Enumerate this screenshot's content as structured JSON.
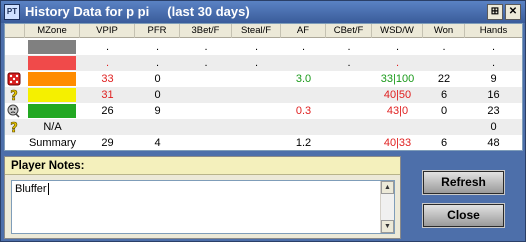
{
  "window": {
    "title": "History Data for p pi     (last 30 days)",
    "app_icon_text": "PT"
  },
  "columns": [
    "MZone",
    "VPIP",
    "PFR",
    "3Bet/F",
    "Steal/F",
    "AF",
    "CBet/F",
    "WSD/W",
    "Won",
    "Hands"
  ],
  "rows": [
    {
      "icon": "",
      "mzone_label": "",
      "mzone_color": "#808080",
      "vpip": ".",
      "pfr": ".",
      "bet3": ".",
      "steal": ".",
      "af": ".",
      "cbet": ".",
      "wsd": ".",
      "won": ".",
      "hands": "."
    },
    {
      "icon": "",
      "mzone_label": "",
      "mzone_color": "#f04a4a",
      "vpip": ".",
      "pfr": ".",
      "bet3": ".",
      "steal": ".",
      "af": "",
      "cbet": ".",
      "wsd": ".",
      "won": "",
      "hands": "."
    },
    {
      "icon": "dice-icon",
      "mzone_label": "",
      "mzone_color": "#ff8c00",
      "vpip": "33",
      "pfr": "0",
      "bet3": "",
      "steal": "",
      "af": "3.0",
      "cbet": "",
      "wsd": "33|100",
      "won": "22",
      "hands": "9"
    },
    {
      "icon": "question-icon",
      "mzone_label": "",
      "mzone_color": "#f5f000",
      "vpip": "31",
      "pfr": "0",
      "bet3": "",
      "steal": "",
      "af": "",
      "cbet": "",
      "wsd": "40|50",
      "won": "6",
      "hands": "16"
    },
    {
      "icon": "thinking-face-icon",
      "mzone_label": "",
      "mzone_color": "#22a822",
      "vpip": "26",
      "pfr": "9",
      "bet3": "",
      "steal": "",
      "af": "0.3",
      "cbet": "",
      "wsd": "43|0",
      "won": "0",
      "hands": "23"
    },
    {
      "icon": "question-icon",
      "mzone_label": "N/A",
      "mzone_color": "",
      "vpip": "",
      "pfr": "",
      "bet3": "",
      "steal": "",
      "af": "",
      "cbet": "",
      "wsd": "",
      "won": "",
      "hands": "0"
    },
    {
      "icon": "",
      "mzone_label": "Summary",
      "mzone_color": "",
      "vpip": "29",
      "pfr": "4",
      "bet3": "",
      "steal": "",
      "af": "1.2",
      "cbet": "",
      "wsd": "40|33",
      "won": "6",
      "hands": "48"
    }
  ],
  "notes": {
    "header": "Player Notes:",
    "text": "Bluffer"
  },
  "buttons": {
    "refresh": "Refresh",
    "close": "Close"
  },
  "colors": {
    "window_bg": "#4d6faa",
    "titlebar": "#3a5c9a",
    "red_value": "#e02020",
    "green_value": "#1a9a1a"
  }
}
